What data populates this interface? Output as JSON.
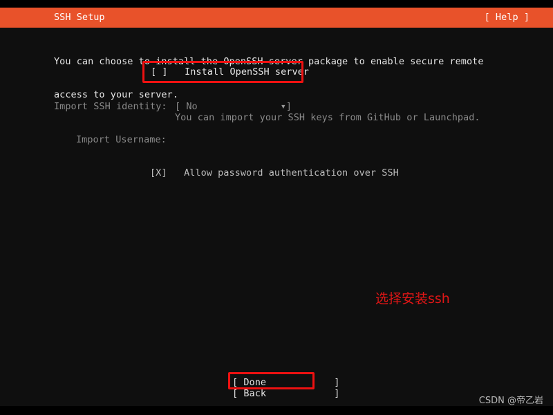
{
  "window": {
    "title": "SSH Setup",
    "help_label": "[ Help ]",
    "accent_color": "#e8522a",
    "background_color": "#0f0f0f",
    "highlight_color": "#ee1111"
  },
  "intro": {
    "line1": "You can choose to install the OpenSSH server package to enable secure remote",
    "line2": "access to your server."
  },
  "install_openssh": {
    "checkbox": "[ ]",
    "label": "Install OpenSSH server",
    "row_text": "[ ]   Install OpenSSH server",
    "checked": false
  },
  "import_identity": {
    "label": "Import SSH identity:",
    "selected_value": "No",
    "select_text": "[ No",
    "caret": "▾",
    "select_close": "]",
    "hint": "You can import your SSH keys from GitHub or Launchpad."
  },
  "import_username": {
    "label": "Import Username:",
    "value": ""
  },
  "allow_password_auth": {
    "checkbox": "[X]",
    "label": "Allow password authentication over SSH",
    "row_text": "[X]   Allow password authentication over SSH",
    "checked": true
  },
  "annotation": {
    "text": "选择安装ssh",
    "color": "#e01616"
  },
  "footer": {
    "done": "[ Done            ]",
    "back": "[ Back            ]"
  },
  "watermark": {
    "text": "CSDN @帝乙岩"
  }
}
